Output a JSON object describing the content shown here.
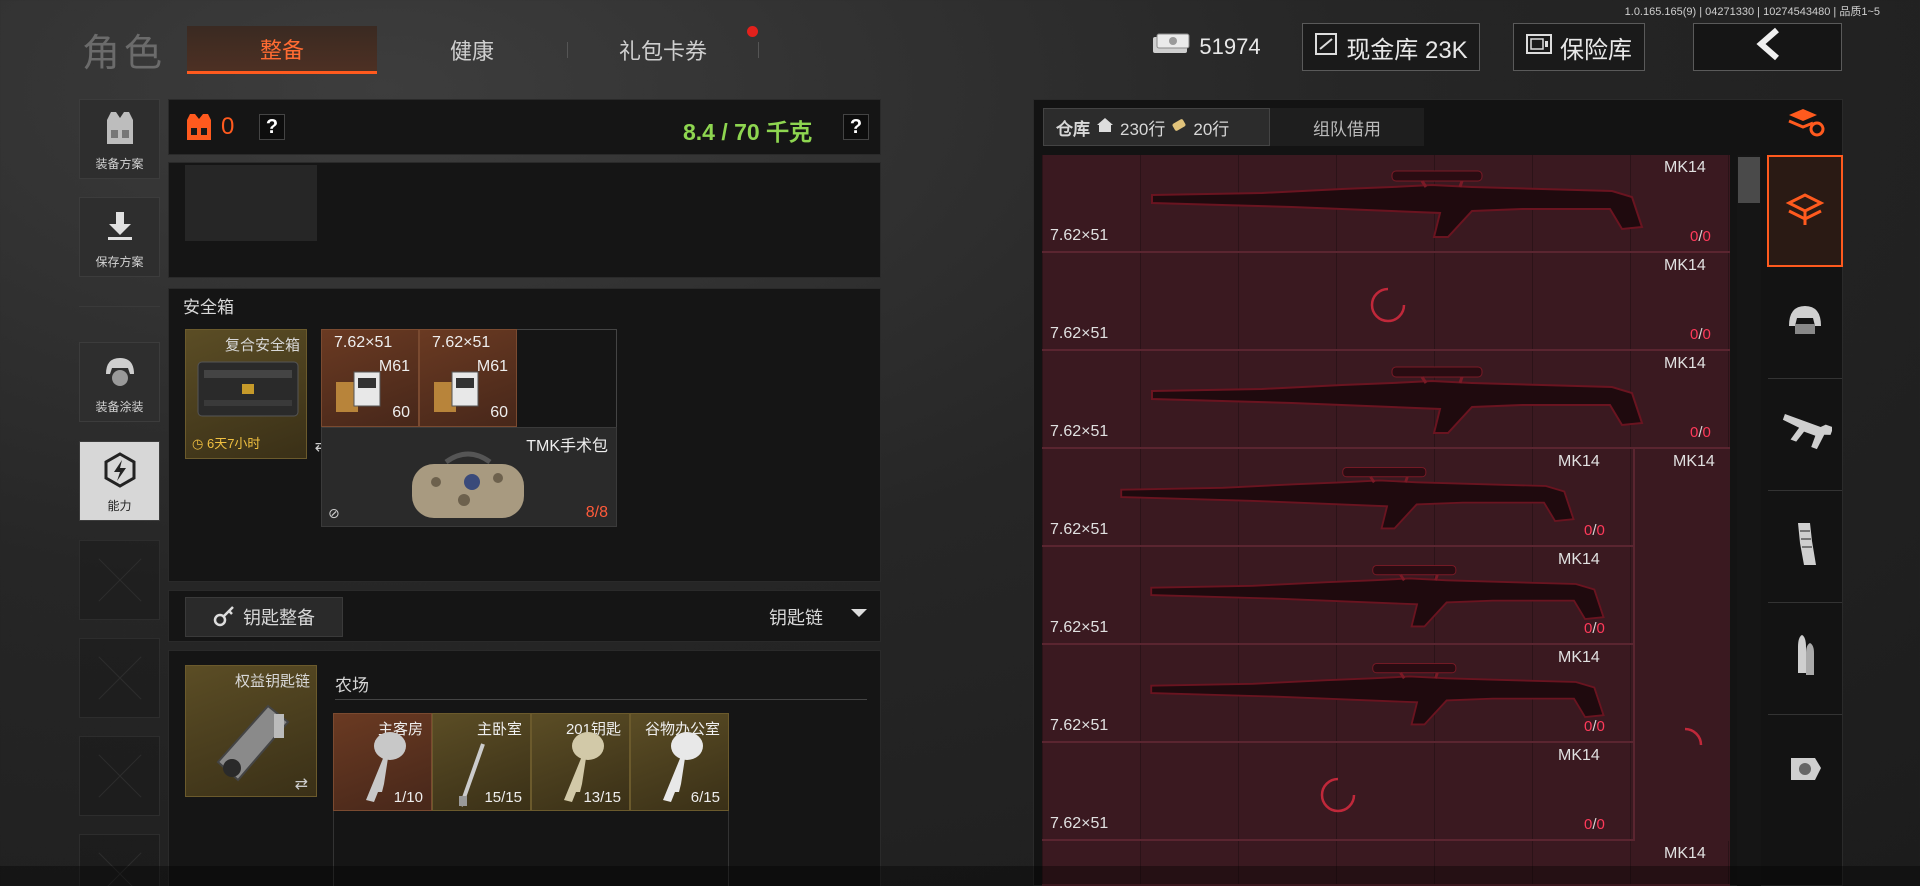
{
  "version_text": "1.0.165.165(9) | 04271330 | 10274543480 | 品质1~5",
  "header": {
    "title": "角色",
    "tabs": [
      {
        "label": "整备"
      },
      {
        "label": "健康"
      },
      {
        "label": "礼包卡券"
      }
    ],
    "currency": "51974",
    "cash_vault": "现金库 23K",
    "insurance_vault": "保险库"
  },
  "sidebar": {
    "items": [
      {
        "label": "装备方案"
      },
      {
        "label": "保存方案"
      },
      {
        "label": "装备涂装"
      },
      {
        "label": "能力"
      }
    ]
  },
  "loadout": {
    "armor_count": "0",
    "weight": "8.4 / 70 千克"
  },
  "safe": {
    "title": "安全箱",
    "box_name": "复合安全箱",
    "timer": "6天7小时",
    "ammo": [
      {
        "caliber": "7.62×51",
        "name": "M61",
        "count": "60"
      },
      {
        "caliber": "7.62×51",
        "name": "M61",
        "count": "60"
      }
    ],
    "medkit": {
      "name": "TMK手术包",
      "count": "8/8"
    }
  },
  "keys": {
    "button": "钥匙整备",
    "chain_label": "钥匙链",
    "keychain_name": "权益钥匙链",
    "location": "农场",
    "items": [
      {
        "name": "主客房",
        "count": "1/10"
      },
      {
        "name": "主卧室",
        "count": "15/15"
      },
      {
        "name": "201钥匙",
        "count": "13/15"
      },
      {
        "name": "谷物办公室",
        "count": "6/15"
      }
    ]
  },
  "warehouse": {
    "tab_label": "仓库",
    "rows_a": "230行",
    "rows_b": "20行",
    "team_borrow": "组队借用",
    "weapons": [
      {
        "name": "MK14",
        "ammo": "7.62×51",
        "cur": "0",
        "max": "0"
      },
      {
        "name": "MK14",
        "ammo": "7.62×51",
        "cur": "0",
        "max": "0"
      },
      {
        "name": "MK14",
        "ammo": "7.62×51",
        "cur": "0",
        "max": "0"
      },
      {
        "name": "MK14",
        "ammo": "7.62×51",
        "cur": "0",
        "max": "0"
      },
      {
        "name": "MK14",
        "ammo": "7.62×51",
        "cur": "0",
        "max": "0"
      },
      {
        "name": "MK14",
        "ammo": "7.62×51",
        "cur": "0",
        "max": "0"
      },
      {
        "name": "MK14",
        "ammo": "7.62×51",
        "cur": "0",
        "max": "0"
      },
      {
        "name": "MK14"
      }
    ],
    "side_weapon": "MK14",
    "count_sep": "/"
  }
}
